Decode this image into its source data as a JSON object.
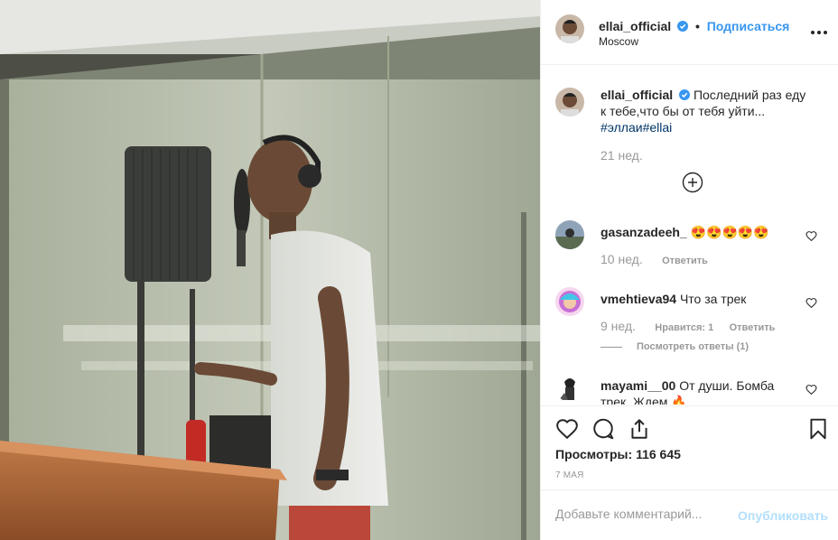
{
  "header": {
    "username": "ellai_official",
    "separator": "•",
    "follow_label": "Подписаться",
    "location": "Moscow"
  },
  "caption": {
    "username": "ellai_official",
    "text": "Последний раз еду к тебе,что бы от тебя уйти...",
    "hashtags": "#эллаи#ellai",
    "time": "21 нед."
  },
  "comments": [
    {
      "username": "gasanzadeeh_",
      "text": "😍😍😍😍😍",
      "time": "10 нед.",
      "reply_label": "Ответить"
    },
    {
      "username": "vmehtieva94",
      "text": "Что за трек",
      "time": "9 нед.",
      "likes_label": "Нравится: 1",
      "reply_label": "Ответить",
      "view_replies": "Посмотреть ответы (1)"
    },
    {
      "username": "mayami__00",
      "text": "От души. Бомба трек. Ждем 🔥"
    }
  ],
  "stats": {
    "views_label": "Просмотры:",
    "views_value": "116 645",
    "date": "7 МАЯ"
  },
  "add_comment": {
    "placeholder": "Добавьте комментарий...",
    "publish_label": "Опубликовать"
  },
  "icons": {
    "verified": "verified-badge-icon",
    "more": "more-options-icon",
    "like": "heart-icon",
    "comment": "comment-icon",
    "share": "share-icon",
    "save": "bookmark-icon",
    "load_more": "plus-circle-icon"
  },
  "colors": {
    "link": "#3897f0",
    "hashtag": "#003569",
    "muted": "#999999",
    "publish_disabled": "#b2dffc"
  }
}
